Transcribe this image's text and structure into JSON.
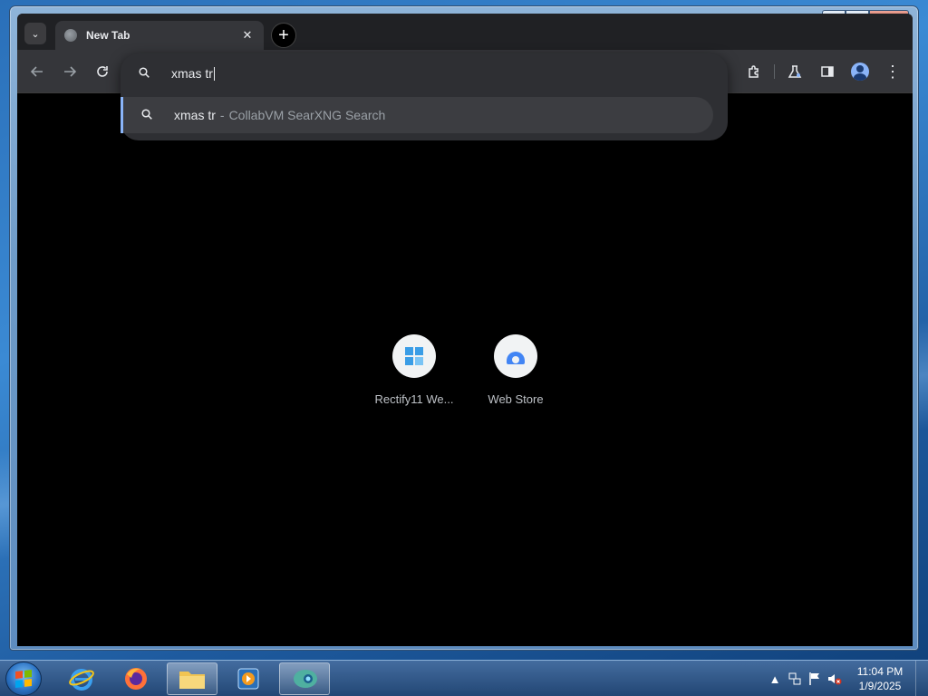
{
  "browser": {
    "tab": {
      "title": "New Tab",
      "close_glyph": "✕"
    },
    "new_tab_glyph": "+",
    "tab_search_glyph": "⌄",
    "omnibox": {
      "query": "xmas tr",
      "suggestion": {
        "query": "xmas tr",
        "separator": "-",
        "provider": "CollabVM SearXNG Search"
      }
    },
    "shortcuts": [
      {
        "label": "Rectify11 We...",
        "icon": "windows11-logo-icon"
      },
      {
        "label": "Web Store",
        "icon": "chrome-web-store-icon"
      }
    ]
  },
  "taskbar": {
    "time": "11:04 PM",
    "date": "1/9/2025",
    "apps": [
      "internet-explorer",
      "firefox",
      "file-explorer",
      "media-player",
      "chrome-active"
    ]
  },
  "colors": {
    "chrome_bg": "#202124",
    "toolbar_bg": "#35363a",
    "accent": "#8ab4f8",
    "content_bg": "#000000"
  }
}
